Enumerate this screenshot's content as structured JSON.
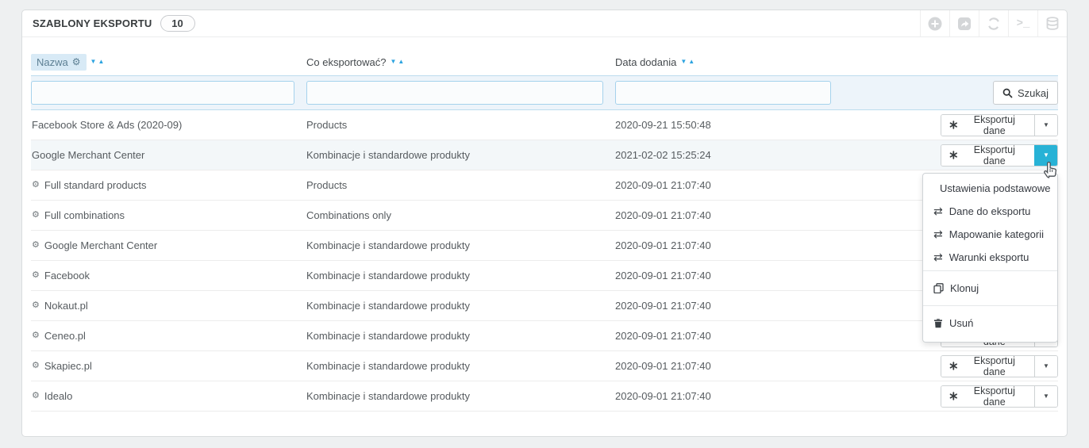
{
  "panel": {
    "title": "SZABLONY EKSPORTU",
    "count": "10"
  },
  "toolbar": {
    "icons": [
      "add-icon",
      "export-icon",
      "refresh-icon",
      "terminal-icon",
      "sql-icon"
    ],
    "terminal_glyph": ">_"
  },
  "table": {
    "columns": [
      {
        "label": "Nazwa",
        "filter_pill": true,
        "sortable": true
      },
      {
        "label": "Co eksportować?",
        "sortable": true
      },
      {
        "label": "Data dodania",
        "sortable": true
      }
    ],
    "filters": {
      "name": "",
      "what": "",
      "date": ""
    },
    "search_button": "Szukaj",
    "export_button": "Eksportuj dane",
    "rows": [
      {
        "name": "Facebook Store & Ads (2020-09)",
        "what": "Products",
        "date": "2020-09-21 15:50:48"
      },
      {
        "name": "Google Merchant Center",
        "what": "Kombinacje i standardowe produkty",
        "date": "2021-02-02 15:25:24"
      },
      {
        "name": "Full standard products",
        "what": "Products",
        "date": "2020-09-01 21:07:40"
      },
      {
        "name": "Full combinations",
        "what": "Combinations only",
        "date": "2020-09-01 21:07:40"
      },
      {
        "name": "Google Merchant Center",
        "what": "Kombinacje i standardowe produkty",
        "date": "2020-09-01 21:07:40"
      },
      {
        "name": "Facebook",
        "what": "Kombinacje i standardowe produkty",
        "date": "2020-09-01 21:07:40"
      },
      {
        "name": "Nokaut.pl",
        "what": "Kombinacje i standardowe produkty",
        "date": "2020-09-01 21:07:40"
      },
      {
        "name": "Ceneo.pl",
        "what": "Kombinacje i standardowe produkty",
        "date": "2020-09-01 21:07:40"
      },
      {
        "name": "Skapiec.pl",
        "what": "Kombinacje i standardowe produkty",
        "date": "2020-09-01 21:07:40"
      },
      {
        "name": "Idealo",
        "what": "Kombinacje i standardowe produkty",
        "date": "2020-09-01 21:07:40"
      }
    ]
  },
  "dropdown": {
    "items": [
      {
        "icon": "pencil-icon",
        "label": "Ustawienia podstawowe"
      },
      {
        "icon": "transfer-icon",
        "label": "Dane do eksportu"
      },
      {
        "icon": "transfer-icon",
        "label": "Mapowanie kategorii"
      },
      {
        "icon": "transfer-icon",
        "label": "Warunki eksportu"
      },
      {
        "icon": "clone-icon",
        "label": "Klonuj"
      },
      {
        "icon": "trash-icon",
        "label": "Usuń"
      }
    ]
  },
  "glyphs": {
    "caret": "▼",
    "sort_down": "▼",
    "sort_up": "▲",
    "gear": "⚙",
    "transfer": "⇄"
  },
  "colors": {
    "accent": "#27b2d6",
    "sort_arrow": "#2da4e0",
    "filter_row_bg": "#edf4fa",
    "row_highlight": "#f3f7f9"
  }
}
